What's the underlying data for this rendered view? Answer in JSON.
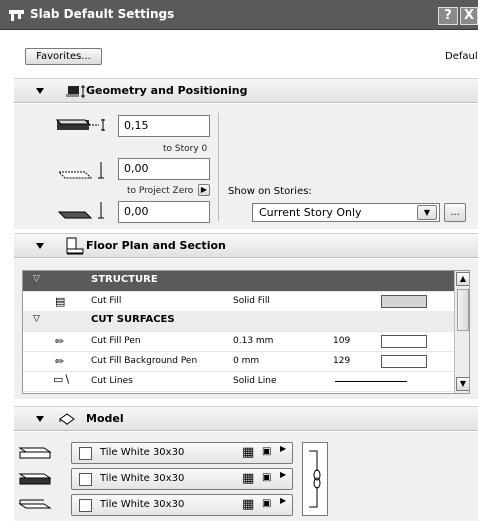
{
  "window": {
    "title": "Slab Default Settings",
    "help_label": "?",
    "close_label": "X"
  },
  "toolbar": {
    "favorites_label": "Favorites...",
    "default_label": "Default"
  },
  "geometry": {
    "title": "Geometry and Positioning",
    "thickness": "0,15",
    "to_story_label": "to Story 0",
    "story_offset": "0,00",
    "to_project_zero_label": "to Project Zero",
    "project_zero_offset": "0,00",
    "show_on_stories_label": "Show on Stories:",
    "show_on_stories_value": "Current Story Only",
    "more_button_label": "..."
  },
  "floorplan": {
    "title": "Floor Plan and Section",
    "rows": [
      {
        "kind": "header",
        "label": "STRUCTURE"
      },
      {
        "kind": "item",
        "label": "Cut Fill",
        "value": "Solid Fill",
        "num": "",
        "icon": "fill-pattern-icon",
        "swatch": "#d4d4d4"
      },
      {
        "kind": "subheader",
        "label": "CUT SURFACES"
      },
      {
        "kind": "item",
        "label": "Cut Fill Pen",
        "value": "0.13 mm",
        "num": "109",
        "icon": "pen-icon",
        "swatch": "#ffffff"
      },
      {
        "kind": "item",
        "label": "Cut Fill Background Pen",
        "value": "0 mm",
        "num": "129",
        "icon": "pen-icon",
        "swatch": "#ffffff"
      },
      {
        "kind": "item",
        "label": "Cut Lines",
        "value": "Solid Line",
        "num": "",
        "icon": "line-icon",
        "swatch": "line"
      }
    ]
  },
  "model": {
    "title": "Model",
    "materials": [
      {
        "label": "Tile White 30x30"
      },
      {
        "label": "Tile White 30x30"
      },
      {
        "label": "Tile White 30x30"
      }
    ]
  }
}
